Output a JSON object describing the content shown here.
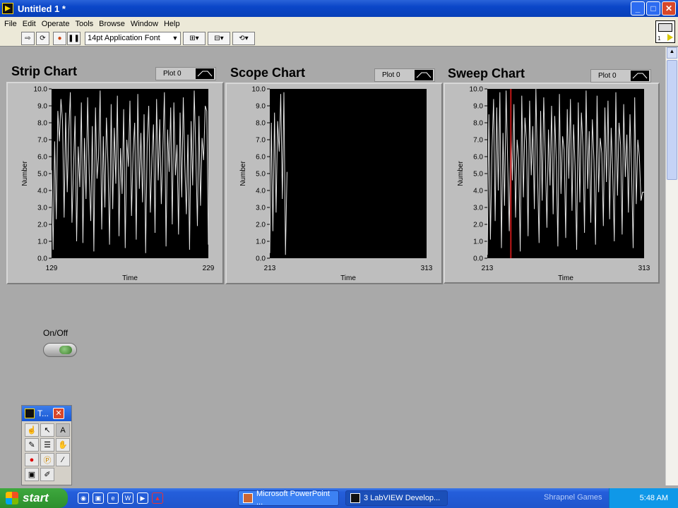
{
  "window": {
    "title": "Untitled 1 *",
    "buttons": [
      "_",
      "□",
      "✕"
    ]
  },
  "menu": [
    "File",
    "Edit",
    "Operate",
    "Tools",
    "Browse",
    "Window",
    "Help"
  ],
  "toolbar": {
    "font": "14pt Application Font"
  },
  "vi_icon": {
    "label": "1"
  },
  "charts": [
    {
      "title": "Strip Chart",
      "color": "#1a1fd8",
      "legend": "Plot 0",
      "xmin": "129",
      "xmax": "229",
      "xlabel": "Time",
      "ylabel": "Number"
    },
    {
      "title": "Scope Chart",
      "color": "#d41446",
      "legend": "Plot 0",
      "xmin": "213",
      "xmax": "313",
      "xlabel": "Time",
      "ylabel": "Number"
    },
    {
      "title": "Sweep Chart",
      "color": "#d99a14",
      "legend": "Plot 0",
      "xmin": "213",
      "xmax": "313",
      "xlabel": "Time",
      "ylabel": "Number"
    }
  ],
  "yticks": [
    "10.0",
    "9.0",
    "8.0",
    "7.0",
    "6.0",
    "5.0",
    "4.0",
    "3.0",
    "2.0",
    "1.0",
    "0.0"
  ],
  "onoff": {
    "label": "On/Off"
  },
  "tools_palette": {
    "title": "T..."
  },
  "taskbar": {
    "start": "start",
    "tasks": [
      "Microsoft PowerPoint ...",
      "3 LabVIEW Develop..."
    ],
    "shrapnel": "Shrapnel Games",
    "clock": "5:48 AM"
  },
  "chart_data": [
    {
      "type": "line",
      "title": "Strip Chart",
      "xlabel": "Time",
      "ylabel": "Number",
      "xlim": [
        129,
        229
      ],
      "ylim": [
        0,
        10
      ],
      "legend": "Plot 0",
      "series": [
        {
          "name": "Plot 0",
          "x_start": 129,
          "x_step": 1,
          "values": [
            5.2,
            0.5,
            6.9,
            2.3,
            8.7,
            6.9,
            9.4,
            8.1,
            2.4,
            8.6,
            3.9,
            7.5,
            9.8,
            2.1,
            5.3,
            8.4,
            1.0,
            6.6,
            4.2,
            9.2,
            0.9,
            7.1,
            3.5,
            9.5,
            5.0,
            2.2,
            7.8,
            0.4,
            8.9,
            4.7,
            6.0,
            9.9,
            1.7,
            7.2,
            3.0,
            8.3,
            5.6,
            0.8,
            9.1,
            2.9,
            7.7,
            4.4,
            9.6,
            1.3,
            6.5,
            3.8,
            8.8,
            0.6,
            7.0,
            5.4,
            9.3,
            2.5,
            6.2,
            8.0,
            1.1,
            9.7,
            4.1,
            7.4,
            3.3,
            8.5,
            0.3,
            6.8,
            9.0,
            2.7,
            5.9,
            7.9,
            1.5,
            9.4,
            4.6,
            8.2,
            3.2,
            6.4,
            9.8,
            0.7,
            7.6,
            5.1,
            8.9,
            2.0,
            9.2,
            4.9,
            6.7,
            1.4,
            8.6,
            3.6,
            9.5,
            5.5,
            2.6,
            7.3,
            0.5,
            8.1,
            4.3,
            9.9,
            6.3,
            1.9,
            8.4,
            3.1,
            7.1,
            5.8,
            9.0,
            8.7,
            0.8
          ]
        }
      ]
    },
    {
      "type": "line",
      "title": "Scope Chart",
      "xlabel": "Time",
      "ylabel": "Number",
      "xlim": [
        213,
        313
      ],
      "ylim": [
        0,
        10
      ],
      "legend": "Plot 0",
      "series": [
        {
          "name": "Plot 0",
          "x_start": 213,
          "x_step": 1,
          "values": [
            0.3,
            8.0,
            1.6,
            8.6,
            2.7,
            8.1,
            6.3,
            9.7,
            3.5,
            9.8,
            0.2,
            5.1
          ]
        }
      ]
    },
    {
      "type": "line",
      "title": "Sweep Chart",
      "xlabel": "Time",
      "ylabel": "Number",
      "xlim": [
        213,
        313
      ],
      "ylim": [
        0,
        10
      ],
      "legend": "Plot 0",
      "sweep_line_x": 228,
      "series": [
        {
          "name": "Plot 0",
          "x_start": 213,
          "x_step": 1,
          "values": [
            0.2,
            8.5,
            1.1,
            6.5,
            9.4,
            2.2,
            8.9,
            4.0,
            9.8,
            0.6,
            7.4,
            3.1,
            9.9,
            5.5,
            1.6,
            8.1,
            4.6,
            9.1,
            2.4,
            7.0,
            5.9,
            0.4,
            9.6,
            3.6,
            8.3,
            6.9,
            1.3,
            9.3,
            4.9,
            7.8,
            2.9,
            10.0,
            5.2,
            0.9,
            8.7,
            3.4,
            9.5,
            6.1,
            1.8,
            7.6,
            4.3,
            9.0,
            2.6,
            8.4,
            5.7,
            0.7,
            9.7,
            3.8,
            7.2,
            6.4,
            1.2,
            8.8,
            4.7,
            9.4,
            2.8,
            7.9,
            5.4,
            0.5,
            9.2,
            3.3,
            8.6,
            6.6,
            1.5,
            9.9,
            4.1,
            7.5,
            2.1,
            8.2,
            5.8,
            0.8,
            9.6,
            3.9,
            7.1,
            6.2,
            1.9,
            8.9,
            4.5,
            9.3,
            2.3,
            7.7,
            5.0,
            1.0,
            9.8,
            3.7,
            8.0,
            6.7,
            1.4,
            9.1,
            4.8,
            7.3,
            2.7,
            8.5,
            5.3,
            0.6,
            9.5,
            3.2,
            7.0,
            6.0,
            3.4,
            3.9,
            3.9
          ]
        }
      ]
    }
  ]
}
